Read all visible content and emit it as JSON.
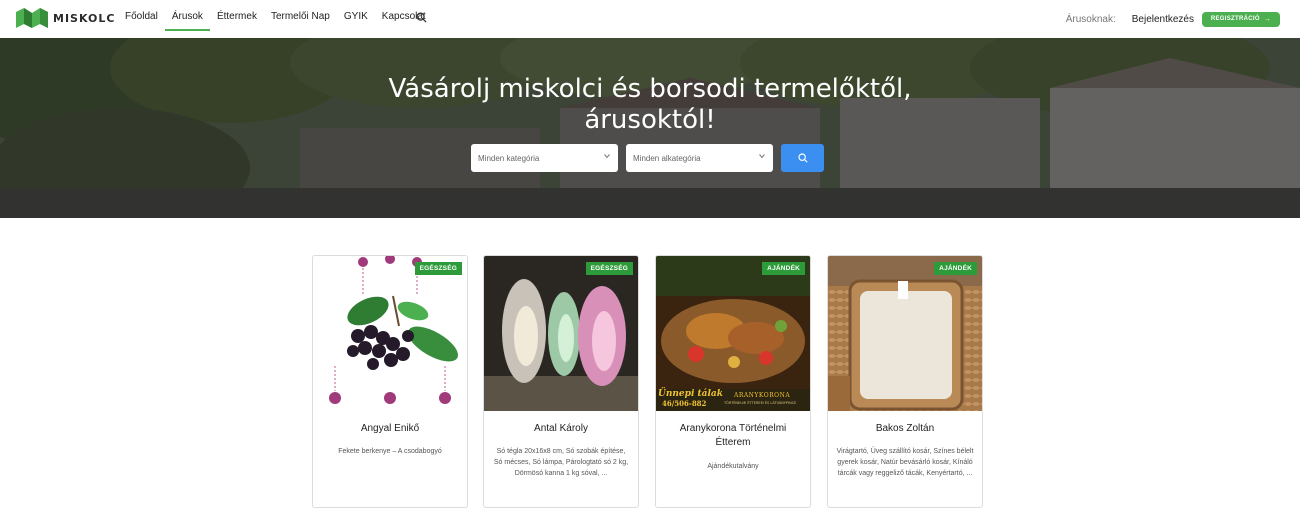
{
  "brand": {
    "name": "MISKOLC"
  },
  "nav": {
    "items": [
      {
        "label": "Főoldal",
        "active": false
      },
      {
        "label": "Árusok",
        "active": true
      },
      {
        "label": "Éttermek",
        "active": false
      },
      {
        "label": "Termelői Nap",
        "active": false
      },
      {
        "label": "GYIK",
        "active": false
      },
      {
        "label": "Kapcsolat",
        "active": false
      }
    ],
    "search_icon": "search-icon",
    "sellers_label": "Árusoknak:",
    "login_label": "Bejelentkezés",
    "register_label": "REGISZTRÁCIÓ",
    "register_icon": "arrow-right-icon"
  },
  "hero": {
    "title_line1": "Vásárolj miskolci és borsodi termelőktől,",
    "title_line2": "árusoktól!",
    "category_placeholder": "Minden kategória",
    "subcategory_placeholder": "Minden alkategória",
    "search_icon": "search-icon"
  },
  "cards": [
    {
      "name": "Angyal Enikő",
      "badge": "EGÉSZSÉG",
      "description": "Fekete berkenye – A csodabogyó"
    },
    {
      "name": "Antal Károly",
      "badge": "EGÉSZSÉG",
      "description": "Só tégla 20x16x8 cm, Só szobák építése, Só mécses, Só lámpa, Párologtató só 2 kg, Dörmösó kanna 1 kg sóval, ..."
    },
    {
      "name": "Aranykorona Történelmi Étterem",
      "badge": "AJÁNDÉK",
      "description": "Ajándékutalvány",
      "image_text_1": "Ünnepi tálak",
      "image_text_2": "46/506-882",
      "image_text_3": "ARANYKORONA",
      "image_text_4": "TÖRTÉNELMI ÉTTEREM ÉS LÁTVÁNYPINCE"
    },
    {
      "name": "Bakos Zoltán",
      "badge": "AJÁNDÉK",
      "description": "Virágtartó, Üveg szállító kosár, Színes bélelt gyerek kosár, Natúr bevásárló kosár, Kínáló tárcák vagy reggeliző tácák, Kenyértartó, ..."
    }
  ],
  "colors": {
    "accent": "#4caf50",
    "badge": "#2e9b3a",
    "search_button": "#3b8ff0"
  }
}
